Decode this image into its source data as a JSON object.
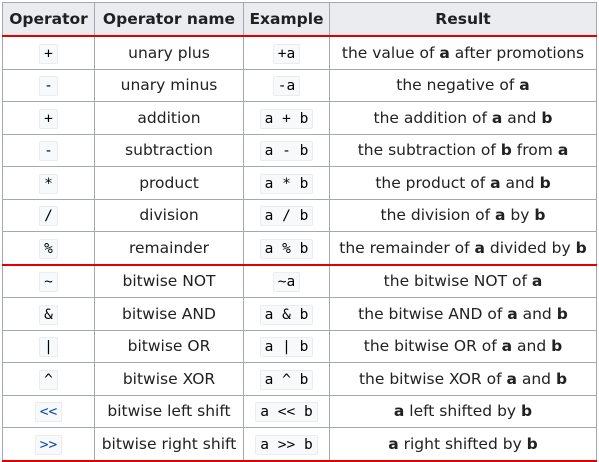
{
  "headers": [
    "Operator",
    "Operator name",
    "Example",
    "Result"
  ],
  "rows": [
    {
      "op": "+",
      "name": "unary plus",
      "example": "+a",
      "result": [
        {
          "t": "the value of "
        },
        {
          "b": "a"
        },
        {
          "t": " after promotions"
        }
      ]
    },
    {
      "op": "-",
      "name": "unary minus",
      "example": "-a",
      "result": [
        {
          "t": "the negative of "
        },
        {
          "b": "a"
        }
      ]
    },
    {
      "op": "+",
      "name": "addition",
      "example": "a + b",
      "result": [
        {
          "t": "the addition of "
        },
        {
          "b": "a"
        },
        {
          "t": " and "
        },
        {
          "b": "b"
        }
      ]
    },
    {
      "op": "-",
      "name": "subtraction",
      "example": "a - b",
      "result": [
        {
          "t": "the subtraction of "
        },
        {
          "b": "b"
        },
        {
          "t": " from "
        },
        {
          "b": "a"
        }
      ]
    },
    {
      "op": "*",
      "name": "product",
      "example": "a * b",
      "result": [
        {
          "t": "the product of "
        },
        {
          "b": "a"
        },
        {
          "t": " and "
        },
        {
          "b": "b"
        }
      ]
    },
    {
      "op": "/",
      "name": "division",
      "example": "a / b",
      "result": [
        {
          "t": "the division of "
        },
        {
          "b": "a"
        },
        {
          "t": " by "
        },
        {
          "b": "b"
        }
      ]
    },
    {
      "op": "%",
      "name": "remainder",
      "example": "a % b",
      "result": [
        {
          "t": "the remainder of "
        },
        {
          "b": "a"
        },
        {
          "t": " divided by "
        },
        {
          "b": "b"
        }
      ],
      "separator": true
    },
    {
      "op": "~",
      "name": "bitwise NOT",
      "example": "~a",
      "result": [
        {
          "t": "the bitwise NOT of "
        },
        {
          "b": "a"
        }
      ]
    },
    {
      "op": "&",
      "name": "bitwise AND",
      "example": "a & b",
      "result": [
        {
          "t": "the bitwise AND of "
        },
        {
          "b": "a"
        },
        {
          "t": " and "
        },
        {
          "b": "b"
        }
      ]
    },
    {
      "op": "|",
      "name": "bitwise OR",
      "example": "a | b",
      "result": [
        {
          "t": "the bitwise OR of "
        },
        {
          "b": "a"
        },
        {
          "t": " and "
        },
        {
          "b": "b"
        }
      ]
    },
    {
      "op": "^",
      "name": "bitwise XOR",
      "example": "a ^ b",
      "result": [
        {
          "t": "the bitwise XOR of "
        },
        {
          "b": "a"
        },
        {
          "t": " and "
        },
        {
          "b": "b"
        }
      ]
    },
    {
      "op": "<<",
      "name": "bitwise left shift",
      "example": "a << b",
      "op_link": true,
      "result": [
        {
          "b": "a"
        },
        {
          "t": " left shifted by "
        },
        {
          "b": "b"
        }
      ]
    },
    {
      "op": ">>",
      "name": "bitwise right shift",
      "example": "a >> b",
      "op_link": true,
      "result": [
        {
          "b": "a"
        },
        {
          "t": " right shifted by "
        },
        {
          "b": "b"
        }
      ],
      "separator": true
    }
  ]
}
